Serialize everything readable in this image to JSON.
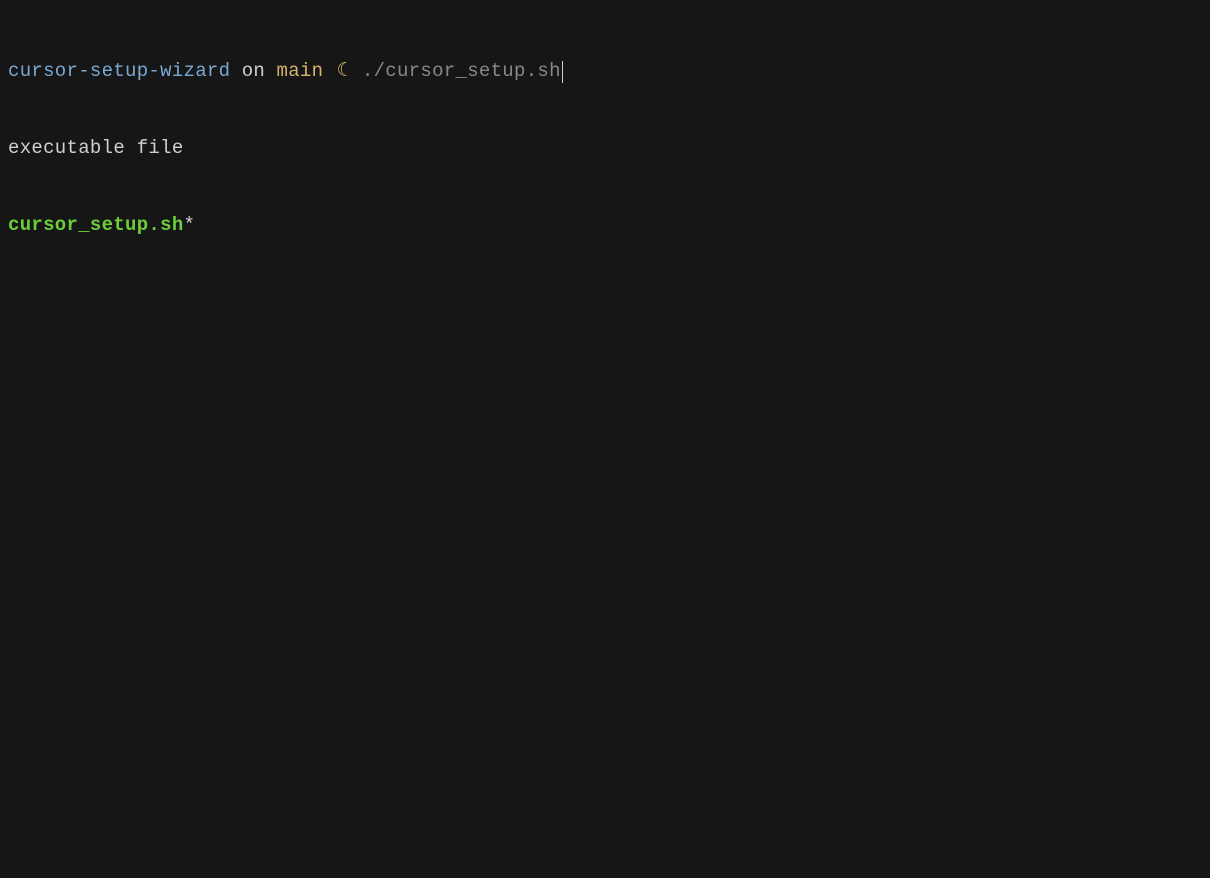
{
  "prompt": {
    "directory": "cursor-setup-wizard",
    "separator": "on",
    "branch": "main",
    "icon": "☾",
    "command": "./cursor_setup.sh"
  },
  "info": {
    "description": "executable file"
  },
  "completion": {
    "filename": "cursor_setup.sh",
    "marker": "*"
  }
}
